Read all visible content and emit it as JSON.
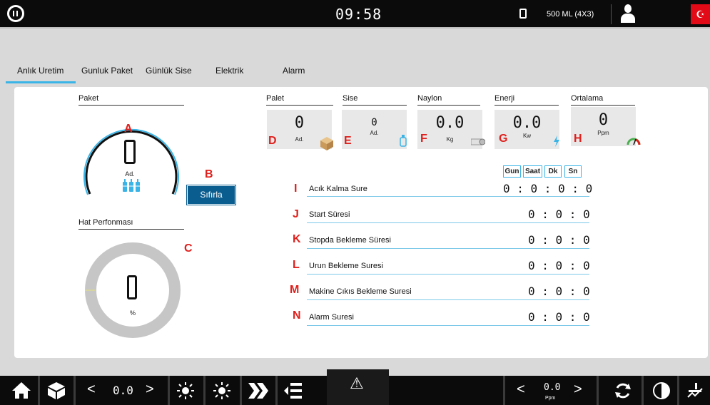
{
  "topbar": {
    "time": "09:58",
    "product": "500 ML  (4X3)",
    "flag": "☪"
  },
  "tabs": [
    "Anlık Uretim",
    "Gunluk Paket",
    "Günlük Sise",
    "Elektrik",
    "Alarm"
  ],
  "paket": {
    "title": "Paket",
    "value": "0",
    "unit": "Ad.",
    "reset_label": "Sıfırla"
  },
  "hat": {
    "title": "Hat Perfonması",
    "value": "0",
    "unit": "%",
    "percent": 0
  },
  "cards": [
    {
      "title": "Palet",
      "value": "0",
      "unit": "Ad.",
      "letter": "D"
    },
    {
      "title": "Sise",
      "value": "0",
      "unit": "Ad.",
      "letter": "E"
    },
    {
      "title": "Naylon",
      "value": "0.0",
      "unit": "Kg",
      "letter": "F"
    },
    {
      "title": "Enerji",
      "value": "0.0",
      "unit": "Kw",
      "letter": "G"
    },
    {
      "title": "Ortalama",
      "value": "0",
      "unit": "Ppm",
      "letter": "H"
    }
  ],
  "letters": {
    "A": "A",
    "B": "B",
    "C": "C"
  },
  "time_headers": [
    "Gun",
    "Saat",
    "Dk",
    "Sn"
  ],
  "rows": [
    {
      "letter": "I",
      "label": "Acık Kalma Sure",
      "value": "0 : 0 : 0 : 0"
    },
    {
      "letter": "J",
      "label": "Start Süresi",
      "value": "0 : 0 : 0"
    },
    {
      "letter": "K",
      "label": "Stopda Bekleme Süresi",
      "value": "0 : 0 : 0"
    },
    {
      "letter": "L",
      "label": "Urun Bekleme Suresi",
      "value": "0 : 0 : 0"
    },
    {
      "letter": "M",
      "label": "Makine Cıkıs Bekleme Suresi",
      "value": "0 : 0 : 0"
    },
    {
      "letter": "N",
      "label": "Alarm Suresi",
      "value": "0 : 0 : 0"
    }
  ],
  "bottombar": {
    "left_value": "0.0",
    "right_value": "0.0",
    "right_unit": "Ppm",
    "prev": "<",
    "next": ">",
    "warn": "⚠"
  },
  "colors": {
    "accent": "#3ab4e6",
    "button": "#0a5d8f",
    "letter": "#e0201c",
    "gauge": "#c6c6c6"
  }
}
